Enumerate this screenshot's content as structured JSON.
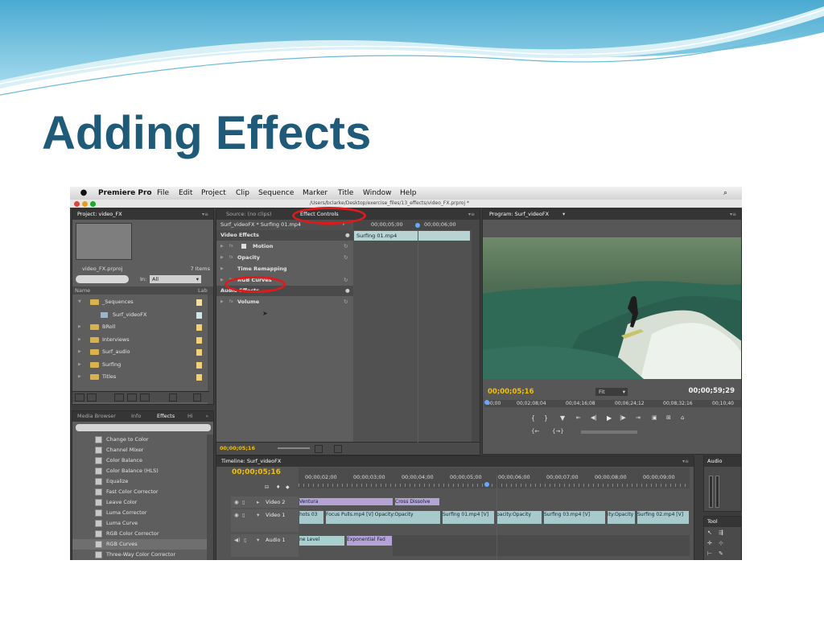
{
  "slide": {
    "title": "Adding Effects"
  },
  "colors": {
    "title": "#1f5a78",
    "timecode": "#f2c000",
    "annotation": "#e2191b",
    "clip_video": "#a7cbcd",
    "transition": "#b6a3d6"
  },
  "menubar": {
    "apple_icon": "apple-icon",
    "app_name": "Premiere Pro",
    "items": [
      "File",
      "Edit",
      "Project",
      "Clip",
      "Sequence",
      "Marker",
      "Title",
      "Window",
      "Help"
    ],
    "search_icon": "spotlight-search-icon",
    "title_path": "/Users/bclarke/Desktop/exercise_files/13_effects/video_FX.prproj *"
  },
  "project_panel": {
    "tab": "Project: video_FX",
    "file": "video_FX.prproj",
    "count": "7 Items",
    "in_label": "In:",
    "in_value": "All",
    "col_name": "Name",
    "col_label": "Lab",
    "items": [
      {
        "name": "_Sequences",
        "color": "#f1e0a0"
      },
      {
        "name": "Surf_videoFX",
        "color": "#cfe6ea"
      },
      {
        "name": "BRoll",
        "color": "#f1d07a"
      },
      {
        "name": "Interviews",
        "color": "#f1d07a"
      },
      {
        "name": "Surf_audio",
        "color": "#f1d07a"
      },
      {
        "name": "Surfing",
        "color": "#f1d07a"
      },
      {
        "name": "Titles",
        "color": "#f1d07a"
      }
    ]
  },
  "effects_panel": {
    "tabs": [
      "Media Browser",
      "Info",
      "Effects",
      "Hi"
    ],
    "items": [
      "Change to Color",
      "Channel Mixer",
      "Color Balance",
      "Color Balance (HLS)",
      "Equalize",
      "Fast Color Corrector",
      "Leave Color",
      "Luma Corrector",
      "Luma Curve",
      "RGB Color Corrector",
      "RGB Curves",
      "Three-Way Color Corrector"
    ],
    "selected": "RGB Curves"
  },
  "effect_controls": {
    "tabs": [
      "Source: (no clips)",
      "Effect Controls"
    ],
    "clip_title": "Surf_videoFX * Surfing 01.mp4",
    "time_a": "00;00;05;00",
    "time_b": "00;00;06;00",
    "clip_bar": "Surfing 01.mp4",
    "video_effects": "Video Effects",
    "effects": [
      "Motion",
      "Opacity",
      "Time Remapping",
      "RGB Curves"
    ],
    "audio_effects": "Audio Effects",
    "audio_items": [
      "Volume"
    ],
    "timecode": "00;00;05;16"
  },
  "program_panel": {
    "tab": "Program: Surf_videoFX",
    "timecode": "00;00;05;16",
    "fit": "Fit",
    "duration": "00;00;59;29",
    "ruler": [
      "00;00",
      "00;02;08;04",
      "00;04;16;08",
      "00;06;24;12",
      "00;08;32;16",
      "00;10;40"
    ]
  },
  "timeline": {
    "tab": "Timeline: Surf_videoFX",
    "timecode": "00;00;05;16",
    "ruler": [
      "00;00;02;00",
      "00;00;03;00",
      "00;00;04;00",
      "00;00;05;00",
      "00;00;06;00",
      "00;00;07;00",
      "00;00;08;00",
      "00;00;09;00"
    ],
    "tracks": {
      "video2": "Video 2",
      "video1": "Video 1",
      "audio1": "Audio 1"
    },
    "video2_clips": [
      "Ventura",
      "Cross Dissolve"
    ],
    "video1_clips": [
      "hots 03",
      "Focus Pulls.mp4 [V] Opacity:Opacity",
      "Surfing 01.mp4 [V]",
      "pacity:Opacity",
      "Surfing 03.mp4 [V]",
      "ity:Opacity",
      "Surfing 02.mp4 [V]"
    ],
    "audio1_clips": [
      "ne Level",
      "Exponential Fad"
    ]
  },
  "audio_meter": {
    "tab": "Audio"
  },
  "tools_panel": {
    "tab": "Tool"
  }
}
